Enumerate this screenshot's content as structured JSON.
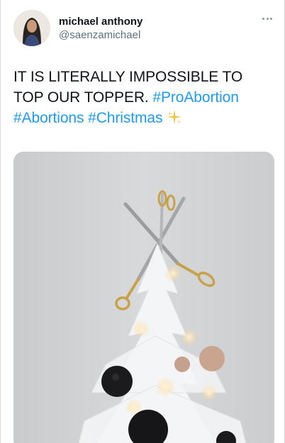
{
  "user": {
    "display_name": "michael anthony",
    "handle": "@saenzamichael"
  },
  "tweet": {
    "text": "IT IS LITERALLY IMPOSSIBLE TO TOP OUR TOPPER.",
    "hashtags": [
      "#ProAbortion",
      "#Abortions",
      "#Christmas"
    ],
    "emoji": "sparkles-icon"
  },
  "icons": {
    "more": "more-options-icon",
    "avatar": "avatar"
  },
  "colors": {
    "hashtag": "#1d9bf0",
    "handle": "#5b7083",
    "sparkle": "#f5c542"
  }
}
